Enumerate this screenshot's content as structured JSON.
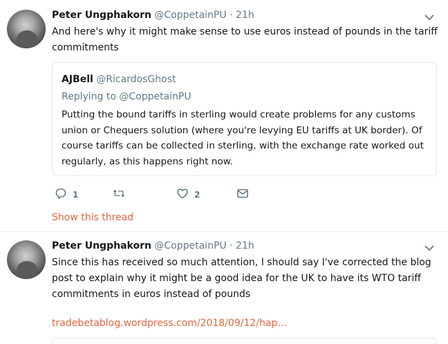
{
  "tweets": [
    {
      "name": "Peter Ungphakorn",
      "handle": "@CoppetainPU",
      "dot": "·",
      "time": "21h",
      "text": "And here's why it might make sense to use euros instead of pounds in the tariff commitments",
      "quote": {
        "name": "AJBell",
        "handle": "@RicardosGhost",
        "replying": "Replying to @CoppetainPU",
        "text": "Putting the bound tariffs in sterling would create problems for any customs union or Chequers solution (where you're levying EU tariffs at UK border). Of course tariffs can be collected in sterling, with the exchange rate worked out regularly, as this happens right now."
      },
      "reply_count": "1",
      "retweet_count": "",
      "like_count": "2",
      "show_thread": "Show this thread"
    },
    {
      "name": "Peter Ungphakorn",
      "handle": "@CoppetainPU",
      "dot": "·",
      "time": "21h",
      "text": "Since this has received so much attention, I should say I've corrected the blog post to explain why it might be a good idea for the UK to have its WTO tariff commitments in euros instead of pounds",
      "link": "tradebetablog.wordpress.com/2018/09/12/hap…"
    }
  ],
  "colors": {
    "accent": "#e0663e",
    "muted": "#657786",
    "border": "#e1e8ed"
  },
  "icons": {
    "caret": "chevron-down-icon",
    "reply": "reply-icon",
    "retweet": "retweet-icon",
    "like": "heart-icon",
    "dm": "envelope-icon"
  }
}
